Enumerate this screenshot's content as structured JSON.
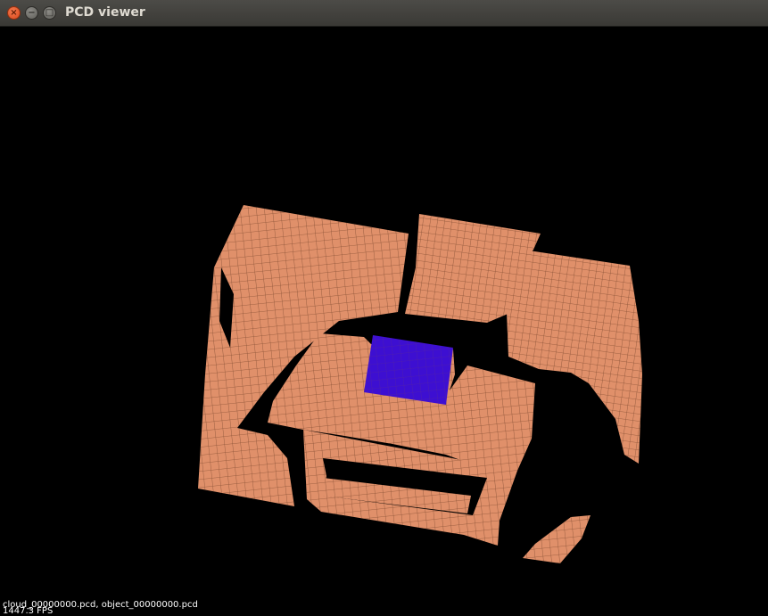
{
  "window": {
    "title": "PCD viewer",
    "close_glyph": "×",
    "minimize_glyph": "−",
    "maximize_glyph": "□"
  },
  "viewer": {
    "loaded_files": "cloud_00000000.pcd, object_00000000.pcd",
    "fps": "1447.3 FPS",
    "colors": {
      "background": "#000000",
      "scene_cloud": "#e0906a",
      "object_cloud": "#3d0fd1",
      "grid_lines": "#8a5236"
    }
  }
}
